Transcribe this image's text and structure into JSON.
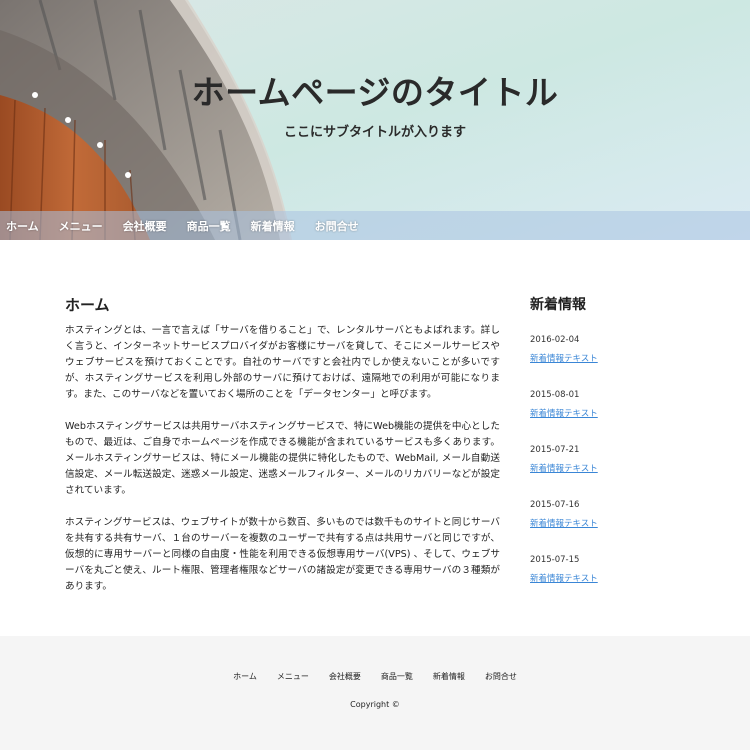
{
  "header": {
    "title": "ホームページのタイトル",
    "subtitle": "ここにサブタイトルが入ります"
  },
  "nav": {
    "items": [
      "ホーム",
      "メニュー",
      "会社概要",
      "商品一覧",
      "新着情報",
      "お問合せ"
    ]
  },
  "main": {
    "title": "ホーム",
    "paragraphs": [
      "ホスティングとは、一言で言えば「サーバを借りること」で、レンタルサーバともよばれます。詳しく言うと、インターネットサービスプロバイダがお客様にサーバを貸して、そこにメールサービスやウェブサービスを預けておくことです。自社のサーバですと会社内でしか使えないことが多いですが、ホスティングサービスを利用し外部のサーバに預けておけば、遠隔地での利用が可能になります。また、このサーバなどを置いておく場所のことを「データセンター」と呼びます。",
      "Webホスティングサービスは共用サーバホスティングサービスで、特にWeb機能の提供を中心としたもので、最近は、ご自身でホームページを作成できる機能が含まれているサービスも多くあります。メールホスティングサービスは、特にメール機能の提供に特化したもので、WebMail, メール自動送信設定、メール転送設定、迷惑メール設定、迷惑メールフィルター、メールのリカバリーなどが設定されています。",
      "ホスティングサービスは、ウェブサイトが数十から数百、多いものでは数千ものサイトと同じサーバを共有する共有サーバ、１台のサーバーを複数のユーザーで共有する点は共用サーバと同じですが、仮想的に専用サーバーと同様の自由度・性能を利用できる仮想専用サーバ(VPS) 、そして、ウェブサーバを丸ごと使え、ルート権限、管理者権限などサーバの諸設定が変更できる専用サーバの３種類があります。"
    ]
  },
  "sidebar": {
    "title": "新着情報",
    "news": [
      {
        "date": "2016-02-04",
        "link": "新着情報テキスト"
      },
      {
        "date": "2015-08-01",
        "link": "新着情報テキスト"
      },
      {
        "date": "2015-07-21",
        "link": "新着情報テキスト"
      },
      {
        "date": "2015-07-16",
        "link": "新着情報テキスト"
      },
      {
        "date": "2015-07-15",
        "link": "新着情報テキスト"
      }
    ]
  },
  "footer": {
    "items": [
      "ホーム",
      "メニュー",
      "会社概要",
      "商品一覧",
      "新着情報",
      "お問合せ"
    ],
    "copyright": "Copyright ©"
  },
  "colors": {
    "link": "#3a86d6",
    "footer_bg": "#f5f5f5",
    "nav_overlay": "#aac3e1"
  }
}
